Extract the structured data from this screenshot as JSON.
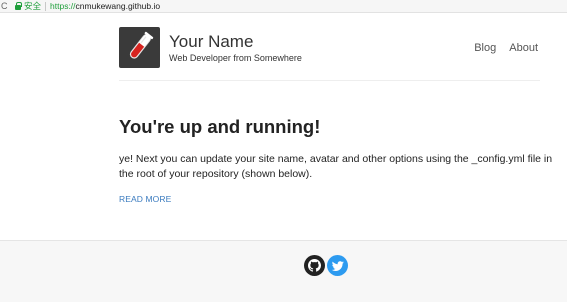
{
  "browser": {
    "reload_glyph": "C",
    "secure_label": "安全",
    "url_scheme": "https://",
    "url_host": "cnmukewang.github.io"
  },
  "site": {
    "name": "Your Name",
    "description": "Web Developer from Somewhere"
  },
  "nav": {
    "items": [
      {
        "label": "Blog"
      },
      {
        "label": "About"
      }
    ]
  },
  "post": {
    "title": "You're up and running!",
    "excerpt": "ye! Next you can update your site name, avatar and other options using the _config.yml file in the root of your repository (shown below).",
    "read_more": "READ MORE"
  },
  "footer": {
    "social": [
      {
        "icon": "github-icon",
        "color": "#222222"
      },
      {
        "icon": "twitter-icon",
        "color": "#2d9bf0"
      }
    ]
  },
  "colors": {
    "secure_green": "#1e9e3a",
    "link_blue": "#3b7bbf",
    "avatar_bg": "#3a3a3a"
  }
}
